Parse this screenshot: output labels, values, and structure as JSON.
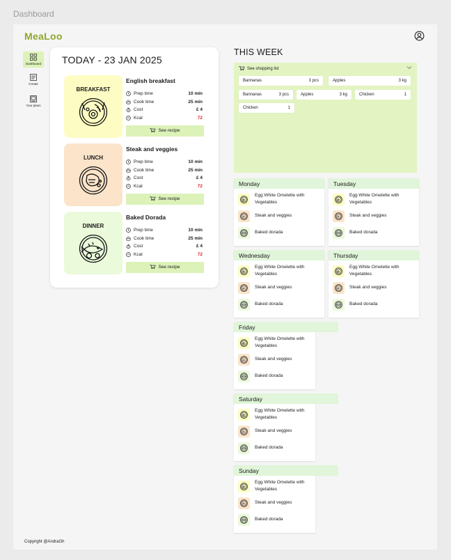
{
  "frame_label": "Dashboard",
  "app": {
    "logo": "MeaLoo"
  },
  "sidebar": {
    "items": [
      {
        "label": "Dashboard",
        "icon": "dashboard-icon",
        "active": true
      },
      {
        "label": "Create",
        "icon": "create-icon",
        "active": false
      },
      {
        "label": "Your plans",
        "icon": "plans-icon",
        "active": false
      }
    ]
  },
  "today": {
    "title": "TODAY - 23 JAN 2025",
    "meals": [
      {
        "type": "BREAKFAST",
        "name": "English breakfast",
        "bg": "#fdfdc3",
        "stats": [
          {
            "label": "Prep time",
            "value": "10 min"
          },
          {
            "label": "Cook time",
            "value": "25 min"
          },
          {
            "label": "Cost",
            "value": "£ 4"
          },
          {
            "label": "Kcal",
            "value": "72"
          }
        ],
        "button": "See recipe"
      },
      {
        "type": "LUNCH",
        "name": "Steak and veggies",
        "bg": "#fbe4c9",
        "stats": [
          {
            "label": "Prep time",
            "value": "10 min"
          },
          {
            "label": "Cook time",
            "value": "25 min"
          },
          {
            "label": "Cost",
            "value": "£ 4"
          },
          {
            "label": "Kcal",
            "value": "72"
          }
        ],
        "button": "See recipe"
      },
      {
        "type": "DINNER",
        "name": "Baked Dorada",
        "bg": "#ebfadb",
        "stats": [
          {
            "label": "Prep time",
            "value": "10 min"
          },
          {
            "label": "Cook time",
            "value": "25 min"
          },
          {
            "label": "Cost",
            "value": "£ 4"
          },
          {
            "label": "Kcal",
            "value": "72"
          }
        ],
        "button": "See recipe"
      }
    ]
  },
  "week": {
    "title": "THIS WEEK",
    "shopping": {
      "label": "See shopping list",
      "items": [
        {
          "name": "Bannanas",
          "qty": "3 pcs"
        },
        {
          "name": "Apples",
          "qty": "3 kg"
        },
        {
          "name": "Bannanas",
          "qty": "3 pcs"
        },
        {
          "name": "Apples",
          "qty": "3 kg"
        },
        {
          "name": "Chicken",
          "qty": "1"
        },
        {
          "name": "Chicken",
          "qty": "1"
        }
      ]
    },
    "days": [
      {
        "name": "Monday",
        "meals": [
          "Egg White Omelette with Vegetables",
          "Steak and veggies",
          "Baked dorada"
        ]
      },
      {
        "name": "Tuesday",
        "meals": [
          "Egg White Omelette with Vegetables",
          "Steak and veggies",
          "Baked dorada"
        ]
      },
      {
        "name": "Wednesday",
        "meals": [
          "Egg White Omelette with Vegetables",
          "Steak and veggies",
          "Baked dorada"
        ]
      },
      {
        "name": "Thursday",
        "meals": [
          "Egg White Omelette with Vegetables",
          "Steak and veggies",
          "Baked dorada"
        ]
      },
      {
        "name": "Friday",
        "meals": [
          "Egg White Omelette with Vegetables",
          "Steak and veggies",
          "Baked dorada"
        ]
      },
      {
        "name": "Saturday",
        "meals": [
          "Egg White Omelette with Vegetables",
          "Steak and veggies",
          "Baked dorada"
        ]
      },
      {
        "name": "Sunday",
        "meals": [
          "Egg White Omelette with Vegetables",
          "Steak and veggies",
          "Baked dorada"
        ]
      }
    ]
  },
  "footer": {
    "copyright": "Copyright @AndraGh"
  },
  "colors": {
    "accent": "#8fa82a",
    "highlight": "#dcf2b8",
    "shopping_bg": "#e3f4c2",
    "day_header": "#e0f5d9",
    "kcal": "#e02424",
    "breakfast": "#fdfdc3",
    "lunch": "#fbe4c9",
    "dinner": "#ebfadb"
  }
}
